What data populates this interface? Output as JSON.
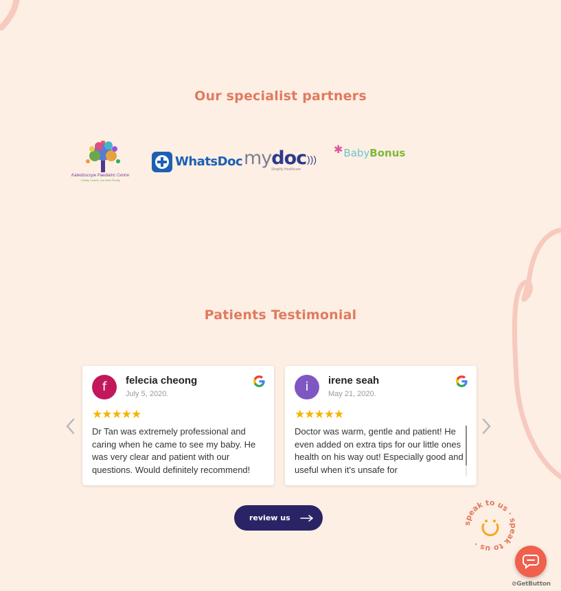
{
  "partners": {
    "title": "Our specialist partners",
    "logos": [
      {
        "name": "Kaleidoscope Paediatric Centre",
        "text": "Kaleidoscope Paediatric Centre",
        "sub": "Family Centric, Our Kids Priority"
      },
      {
        "name": "WhatsDoc",
        "text": "WhatsDoc"
      },
      {
        "name": "mydoc",
        "text_light": "my",
        "text_bold": "doc",
        "sub": "Simplify Healthcare"
      },
      {
        "name": "BabyBonus",
        "text_baby": "Baby",
        "text_bonus": "Bonus"
      }
    ]
  },
  "testimonials": {
    "title": "Patients Testimonial",
    "reviews": [
      {
        "initial": "f",
        "avatar_color": "#c2185b",
        "name": "felecia cheong",
        "date": "July 5, 2020.",
        "stars": "★★★★★",
        "rating": 5,
        "text": "Dr Tan was extremely professional and caring when he came to see my baby. He was very clear and patient with our questions. Would definitely recommend!"
      },
      {
        "initial": "i",
        "avatar_color": "#7e57c2",
        "name": "irene seah",
        "date": "May 21, 2020.",
        "stars": "★★★★★",
        "rating": 5,
        "text": "Doctor was warm, gentle and patient! He even added on extra tips for our little ones health on his way out! Especially good and useful when it's unsafe for"
      }
    ],
    "prev_icon": "chevron-left-icon",
    "next_icon": "chevron-right-icon"
  },
  "review_button": {
    "label": "review us",
    "icon": "arrow-right-icon"
  },
  "speak_badge": {
    "text": "speak to us · speak to us ·"
  },
  "chat_widget": {
    "icon": "chat-bubbles-icon",
    "label": "GetButton"
  },
  "colors": {
    "background": "#fdefe3",
    "accent": "#e07a5f",
    "button": "#2a2466",
    "star": "#f5b400",
    "chat": "#f0604d"
  }
}
